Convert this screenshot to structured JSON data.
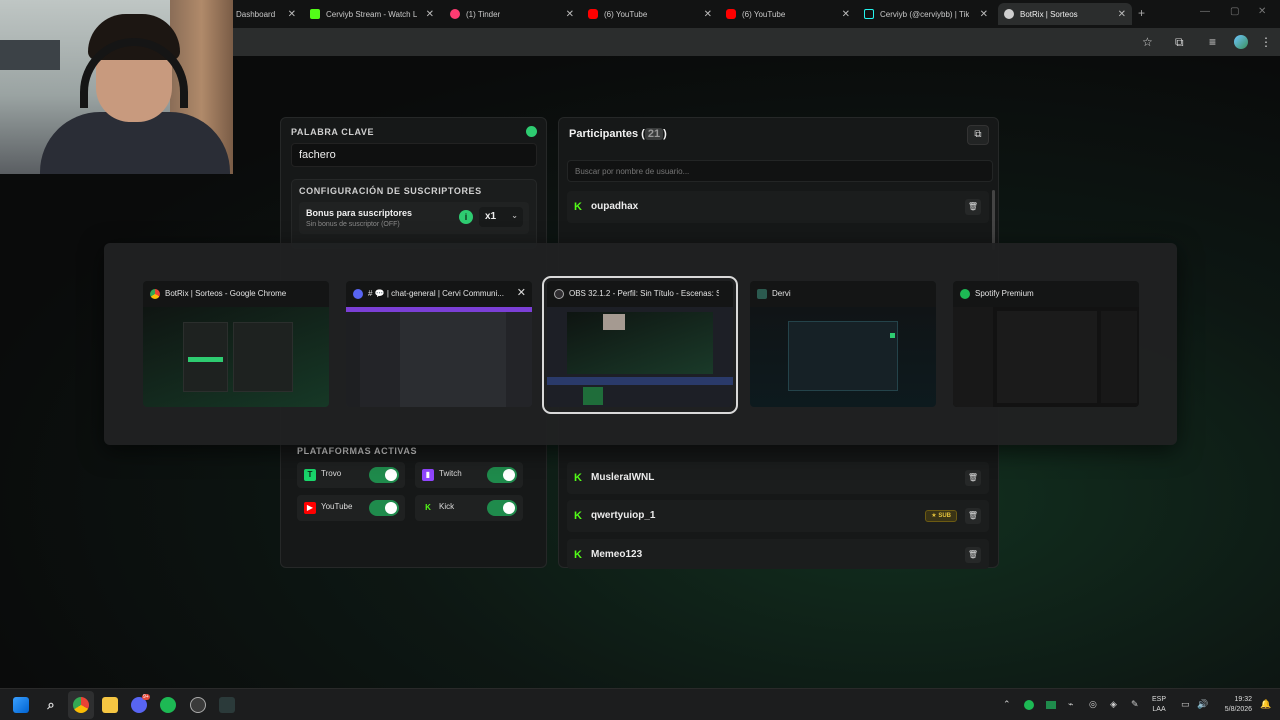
{
  "browser": {
    "tabs": [
      {
        "title": "Dashboard",
        "icon": "dashboard-favicon",
        "color": "#3b3b3b"
      },
      {
        "title": "Cerviyb Stream - Watch L",
        "icon": "kick-favicon",
        "color": "#53fc18"
      },
      {
        "title": "(1) Tinder",
        "icon": "tinder-favicon",
        "color": "#fe3c72"
      },
      {
        "title": "(6) YouTube",
        "icon": "youtube-favicon",
        "color": "#ff0000"
      },
      {
        "title": "(6) YouTube",
        "icon": "youtube-favicon",
        "color": "#ff0000"
      },
      {
        "title": "Cerviyb (@cerviybb) | Tik",
        "icon": "tiktok-favicon",
        "color": "#111111"
      },
      {
        "title": "BotRix | Sorteos",
        "icon": "botrix-favicon",
        "color": "#cfcfcf"
      }
    ],
    "new_tab": "+"
  },
  "left_panel": {
    "keyword_label": "PALABRA CLAVE",
    "keyword_value": "fachero",
    "sub_config_label": "CONFIGURACIÓN DE SUSCRIPTORES",
    "bonus_title": "Bonus para suscriptores",
    "bonus_desc": "Sin bonus de suscriptor (OFF)",
    "bonus_info": "i",
    "multiplier": "x1",
    "platforms_label": "PLATAFORMAS ACTIVAS",
    "platforms": [
      {
        "name": "Trovo",
        "icon": "trovo-icon",
        "color": "#19d66b",
        "enabled": true
      },
      {
        "name": "Twitch",
        "icon": "twitch-icon",
        "color": "#9146ff",
        "enabled": true
      },
      {
        "name": "YouTube",
        "icon": "youtube-icon",
        "color": "#ff0000",
        "enabled": true
      },
      {
        "name": "Kick",
        "icon": "kick-icon",
        "color": "#53fc18",
        "enabled": true
      }
    ]
  },
  "right_panel": {
    "title": "Participantes",
    "count": "21",
    "search_placeholder": "Buscar por nombre de usuario...",
    "participants_top": [
      {
        "name": "oupadhax",
        "sub": false
      }
    ],
    "participants_bottom": [
      {
        "name": "MusleraIWNL",
        "sub": false
      },
      {
        "name": "qwertyuiop_1",
        "sub": true
      },
      {
        "name": "Memeo123",
        "sub": false
      }
    ],
    "sub_badge": "★ SUB"
  },
  "switcher": {
    "windows": [
      {
        "title": "BotRix | Sorteos - Google Chrome",
        "icon": "chrome-icon",
        "color": "#4285f4",
        "selected": false,
        "close": false
      },
      {
        "title": "# 💬 | chat-general | Cervi Communi...",
        "icon": "discord-icon",
        "color": "#5865f2",
        "selected": false,
        "close": true
      },
      {
        "title": "OBS 32.1.2 - Perfil: Sin Título - Escenas: Si...",
        "icon": "obs-icon",
        "color": "#302e31",
        "selected": true,
        "close": false
      },
      {
        "title": "Dervi",
        "icon": "dervi-icon",
        "color": "#2b5a4f",
        "selected": false,
        "close": false
      },
      {
        "title": "Spotify Premium",
        "icon": "spotify-icon",
        "color": "#1db954",
        "selected": false,
        "close": false
      }
    ],
    "close_glyph": "✕"
  },
  "taskbar": {
    "lang_top": "ESP",
    "lang_bottom": "LAA",
    "time": "19:32",
    "date": "5/8/2026",
    "discord_badge": "9+"
  },
  "colors": {
    "accent_green": "#2ecc71",
    "kick_green": "#53fc18",
    "toggle_on": "#1f8b4c"
  }
}
